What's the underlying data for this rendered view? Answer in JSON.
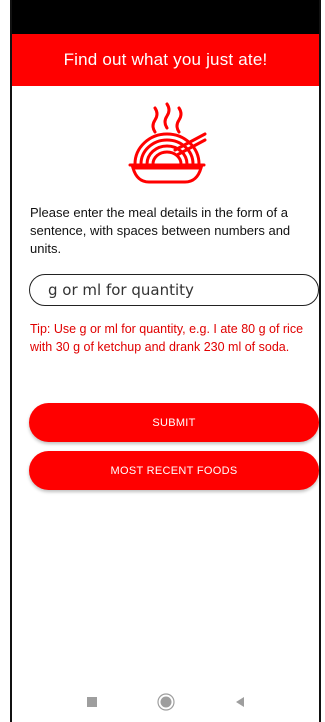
{
  "app": {
    "title": "Find out what you just ate!"
  },
  "main": {
    "instructions": "Please enter the meal details in the form of a sentence, with spaces between numbers and units.",
    "meal_input": {
      "placeholder": "g or ml for quantity",
      "value": ""
    },
    "tip": "Tip: Use g or ml for quantity, e.g. I ate 80 g of rice with 30 g of ketchup and drank 230 ml of soda.",
    "submit_label": "SUBMIT",
    "recent_label": "MOST RECENT FOODS"
  },
  "icons": {
    "header": "noodle-bowl-icon",
    "nav": [
      "square-recents-icon",
      "circle-home-icon",
      "triangle-back-icon"
    ]
  },
  "colors": {
    "accent": "#ff0000",
    "tip_text": "#e00000",
    "status_bar": "#000000",
    "nav_icons": "#9e9e9e"
  }
}
